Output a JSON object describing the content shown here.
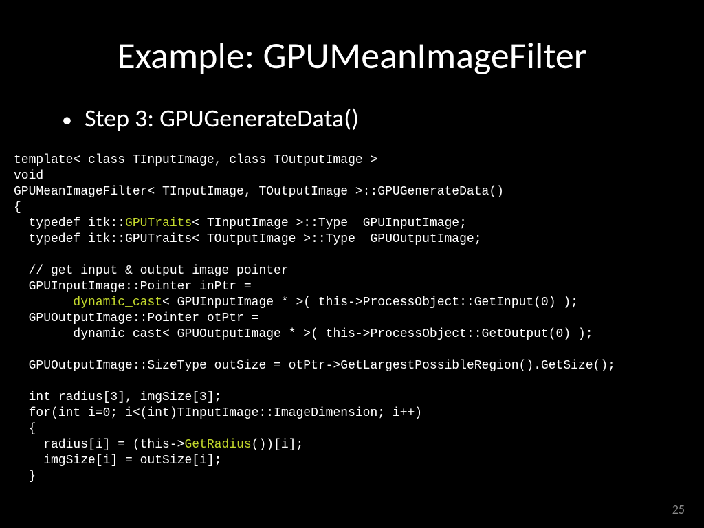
{
  "title": "Example: GPUMeanImageFilter",
  "bullet": "Step 3: GPUGenerateData()",
  "page_number": "25",
  "highlights": {
    "gputraits": "GPUTraits",
    "dyn_cast": "dynamic_cast",
    "getradius": "GetRadius"
  },
  "code": {
    "l01": "template< class TInputImage, class TOutputImage >",
    "l02": "void",
    "l03": "GPUMeanImageFilter< TInputImage, TOutputImage >::GPUGenerateData()",
    "l04": "{",
    "l05a": "  typedef itk::",
    "l05b": "< TInputImage >::Type  GPUInputImage;",
    "l06": "  typedef itk::GPUTraits< TOutputImage >::Type  GPUOutputImage;",
    "l07": "",
    "l08": "  // get input & output image pointer",
    "l09": "  GPUInputImage::Pointer inPtr = ",
    "l10a": "        ",
    "l10b": "< GPUInputImage * >( this->ProcessObject::GetInput(0) );",
    "l11": "  GPUOutputImage::Pointer otPtr = ",
    "l12": "        dynamic_cast< GPUOutputImage * >( this->ProcessObject::GetOutput(0) );",
    "l13": "",
    "l14": "  GPUOutputImage::SizeType outSize = otPtr->GetLargestPossibleRegion().GetSize();",
    "l15": "",
    "l16": "  int radius[3], imgSize[3];",
    "l17": "  for(int i=0; i<(int)TInputImage::ImageDimension; i++)",
    "l18": "  {",
    "l19a": "    radius[i] = (this->",
    "l19b": "())[i];",
    "l20": "    imgSize[i] = outSize[i];",
    "l21": "  }"
  }
}
